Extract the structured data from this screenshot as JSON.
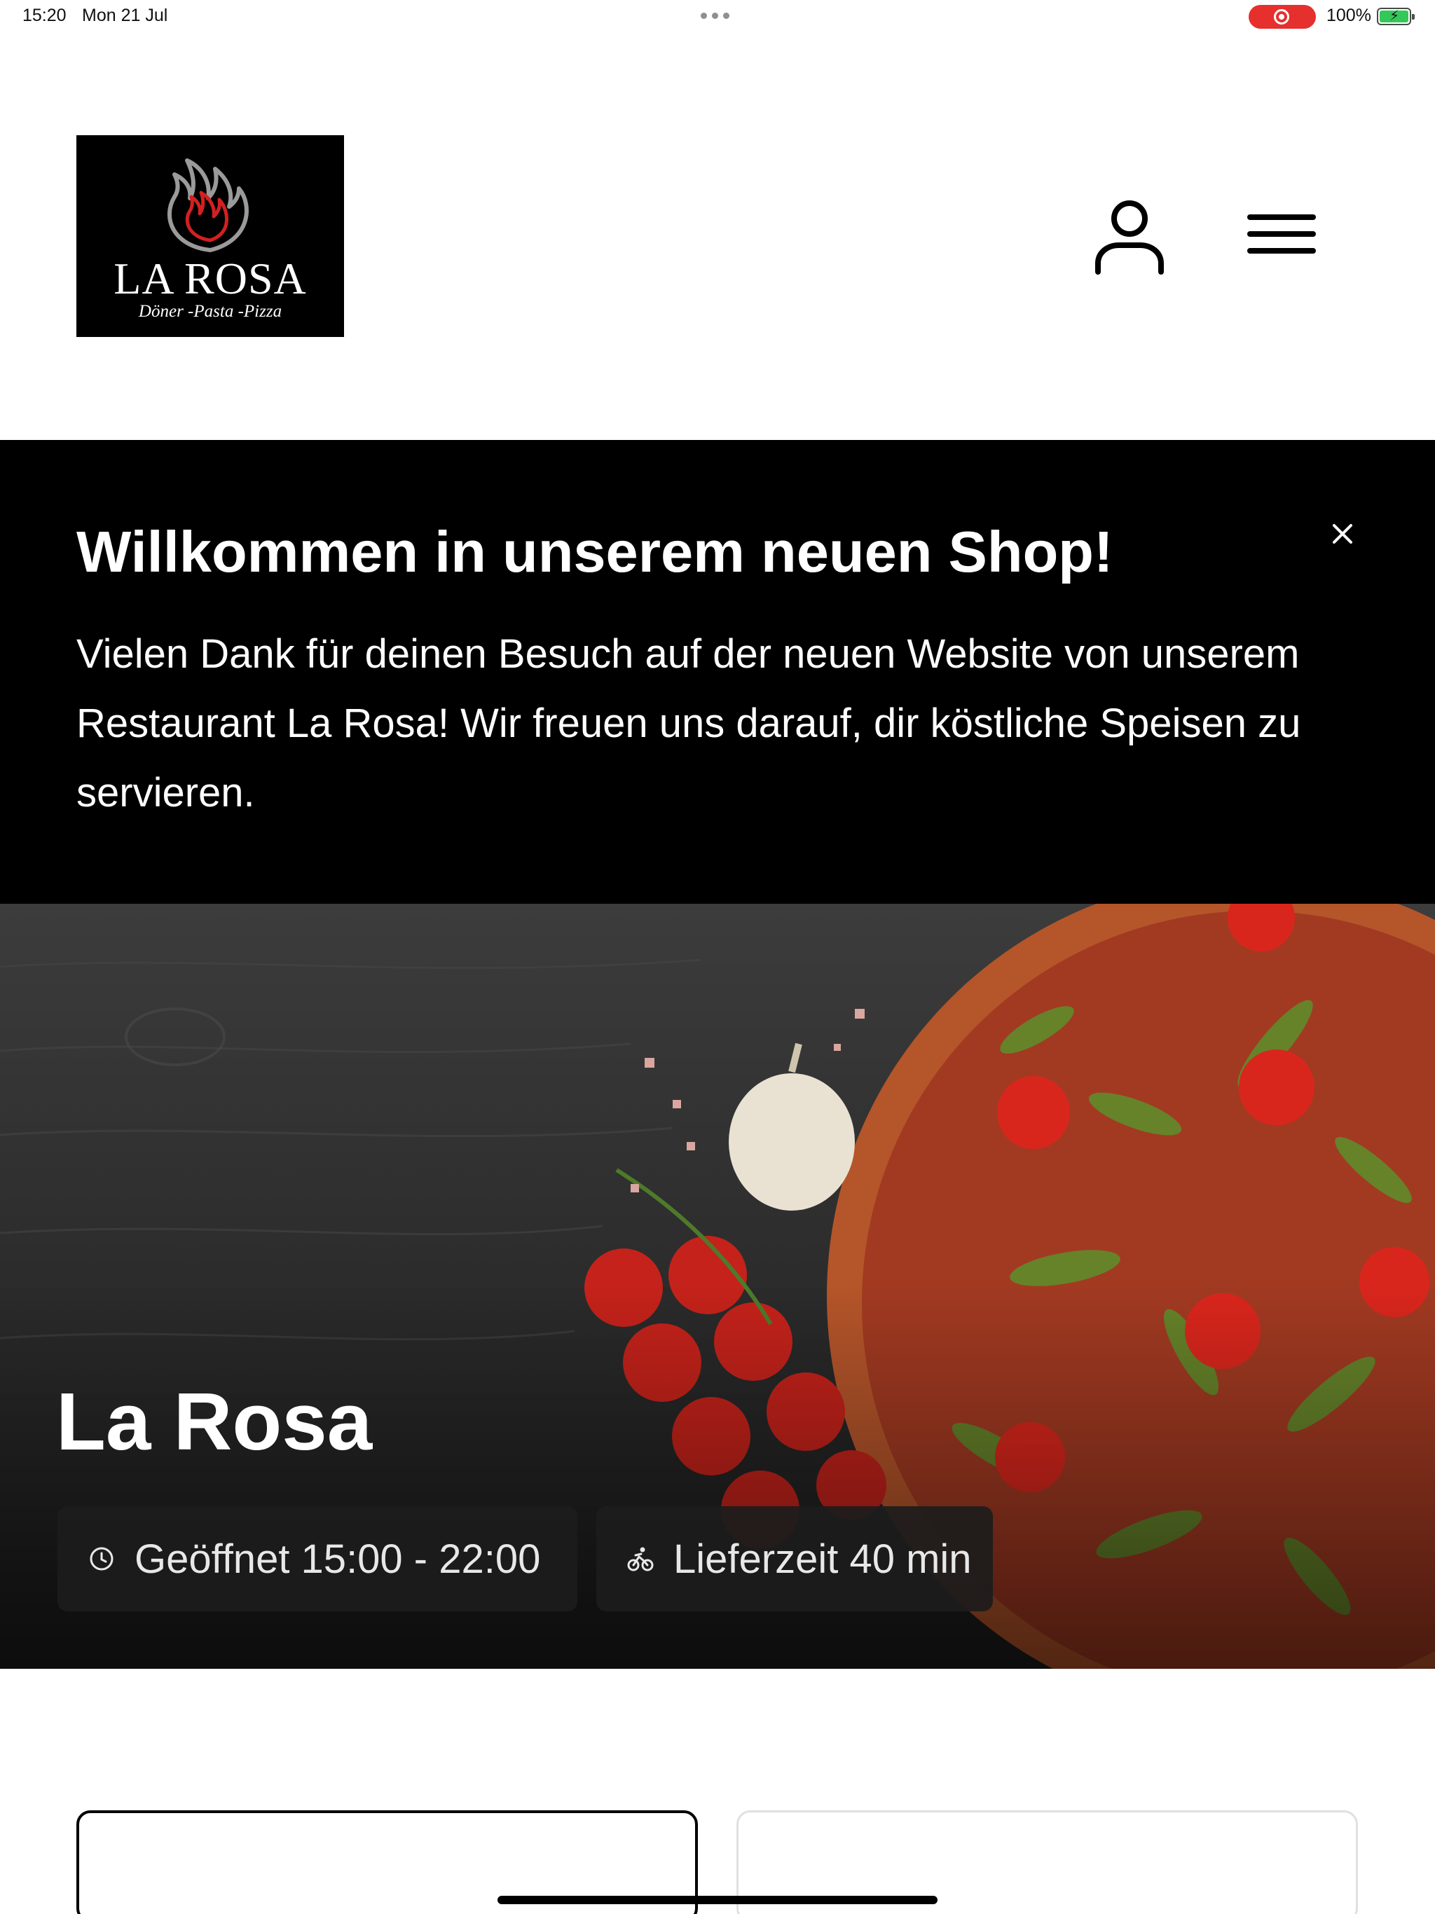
{
  "status_bar": {
    "time": "15:20",
    "date": "Mon 21 Jul",
    "battery_percent": "100%",
    "battery_level": 1.0,
    "recording": true
  },
  "header": {
    "logo": {
      "title": "LA ROSA",
      "subtitle": "Döner -Pasta -Pizza",
      "icon": "flame-icon"
    },
    "account_icon": "user-icon",
    "menu_icon": "hamburger-menu-icon"
  },
  "banner": {
    "title": "Willkommen in unserem neuen Shop!",
    "text": "Vielen Dank für deinen Besuch auf der neuen Website von unserem Restaurant La Rosa! Wir freuen uns darauf, dir köstliche Speisen zu servieren.",
    "close_icon": "close-icon"
  },
  "hero": {
    "title": "La Rosa",
    "opening_hours": "Geöffnet 15:00 - 22:00",
    "opening_icon": "clock-icon",
    "delivery_time": "Lieferzeit 40 min",
    "delivery_icon": "bicycle-icon"
  },
  "colors": {
    "banner_bg": "#000000",
    "chip_bg": "#1c1c1c",
    "recording": "#e5302e",
    "battery": "#34c759"
  }
}
